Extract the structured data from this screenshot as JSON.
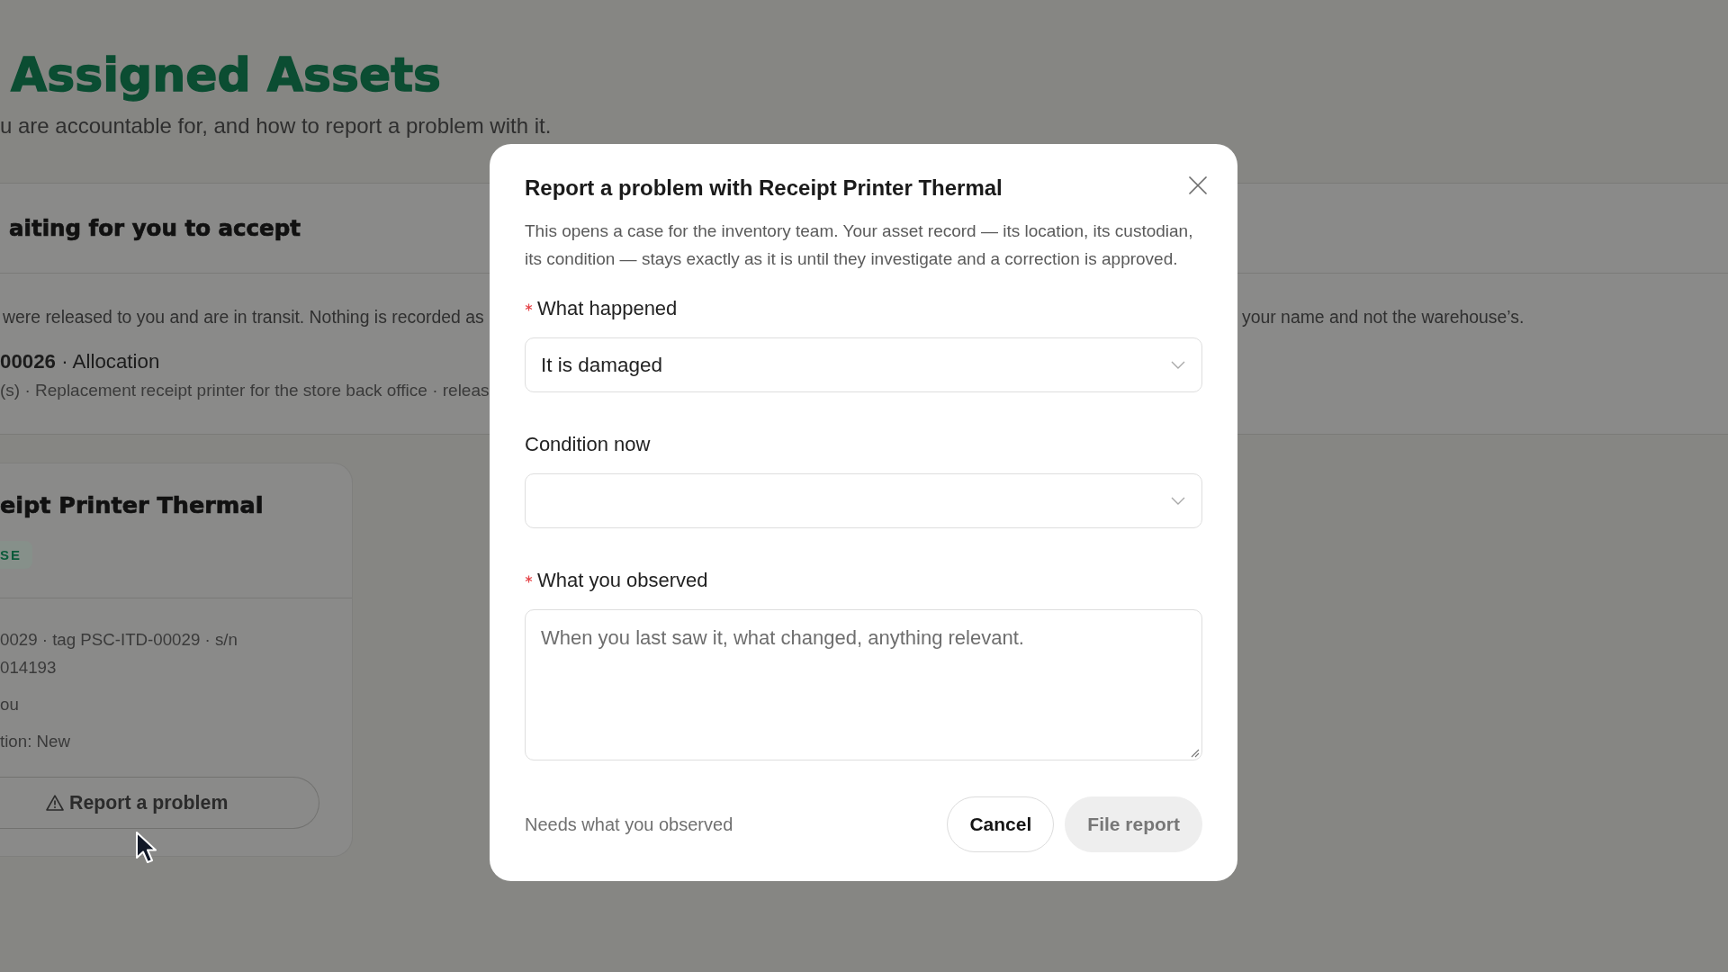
{
  "page": {
    "title": "Assigned Assets",
    "subtitle": "u are accountable for, and how to report a problem with it."
  },
  "pending_section": {
    "heading": "aiting for you to accept",
    "notice": [
      "were released to you and are in transit. Nothing is recorded as",
      "your name and not the warehouse’s."
    ],
    "item": {
      "title": "**00026** · Allocation",
      "details": "(s) · Replacement receipt printer for the store back office · releas"
    }
  },
  "asset_card": {
    "title": "eipt Printer Thermal",
    "status_badge": "SE",
    "details": [
      "0029 · tag PSC-ITD-00029 · s/n 014193",
      "ou",
      "tion: New"
    ],
    "report_button": {
      "label": "Report a problem"
    }
  },
  "dialog": {
    "title": "Report a problem with Receipt Printer Thermal",
    "description": "This opens a case for the inventory team. Your asset record — its location, its custodian, its condition — stays exactly as it is until they investigate and a correction is approved.",
    "fields": [
      {
        "kind": "select",
        "label": "What happened",
        "required": true,
        "value": "It is damaged"
      },
      {
        "kind": "select",
        "label": "Condition now",
        "required": false
      },
      {
        "kind": "textarea",
        "label": "What you observed",
        "required": true,
        "placeholder": "When you last saw it, what changed, anything relevant."
      }
    ],
    "hint": "Needs what you observed",
    "buttons": [
      {
        "label": "Cancel",
        "disabled": false
      },
      {
        "label": "File report",
        "disabled": true
      }
    ]
  }
}
